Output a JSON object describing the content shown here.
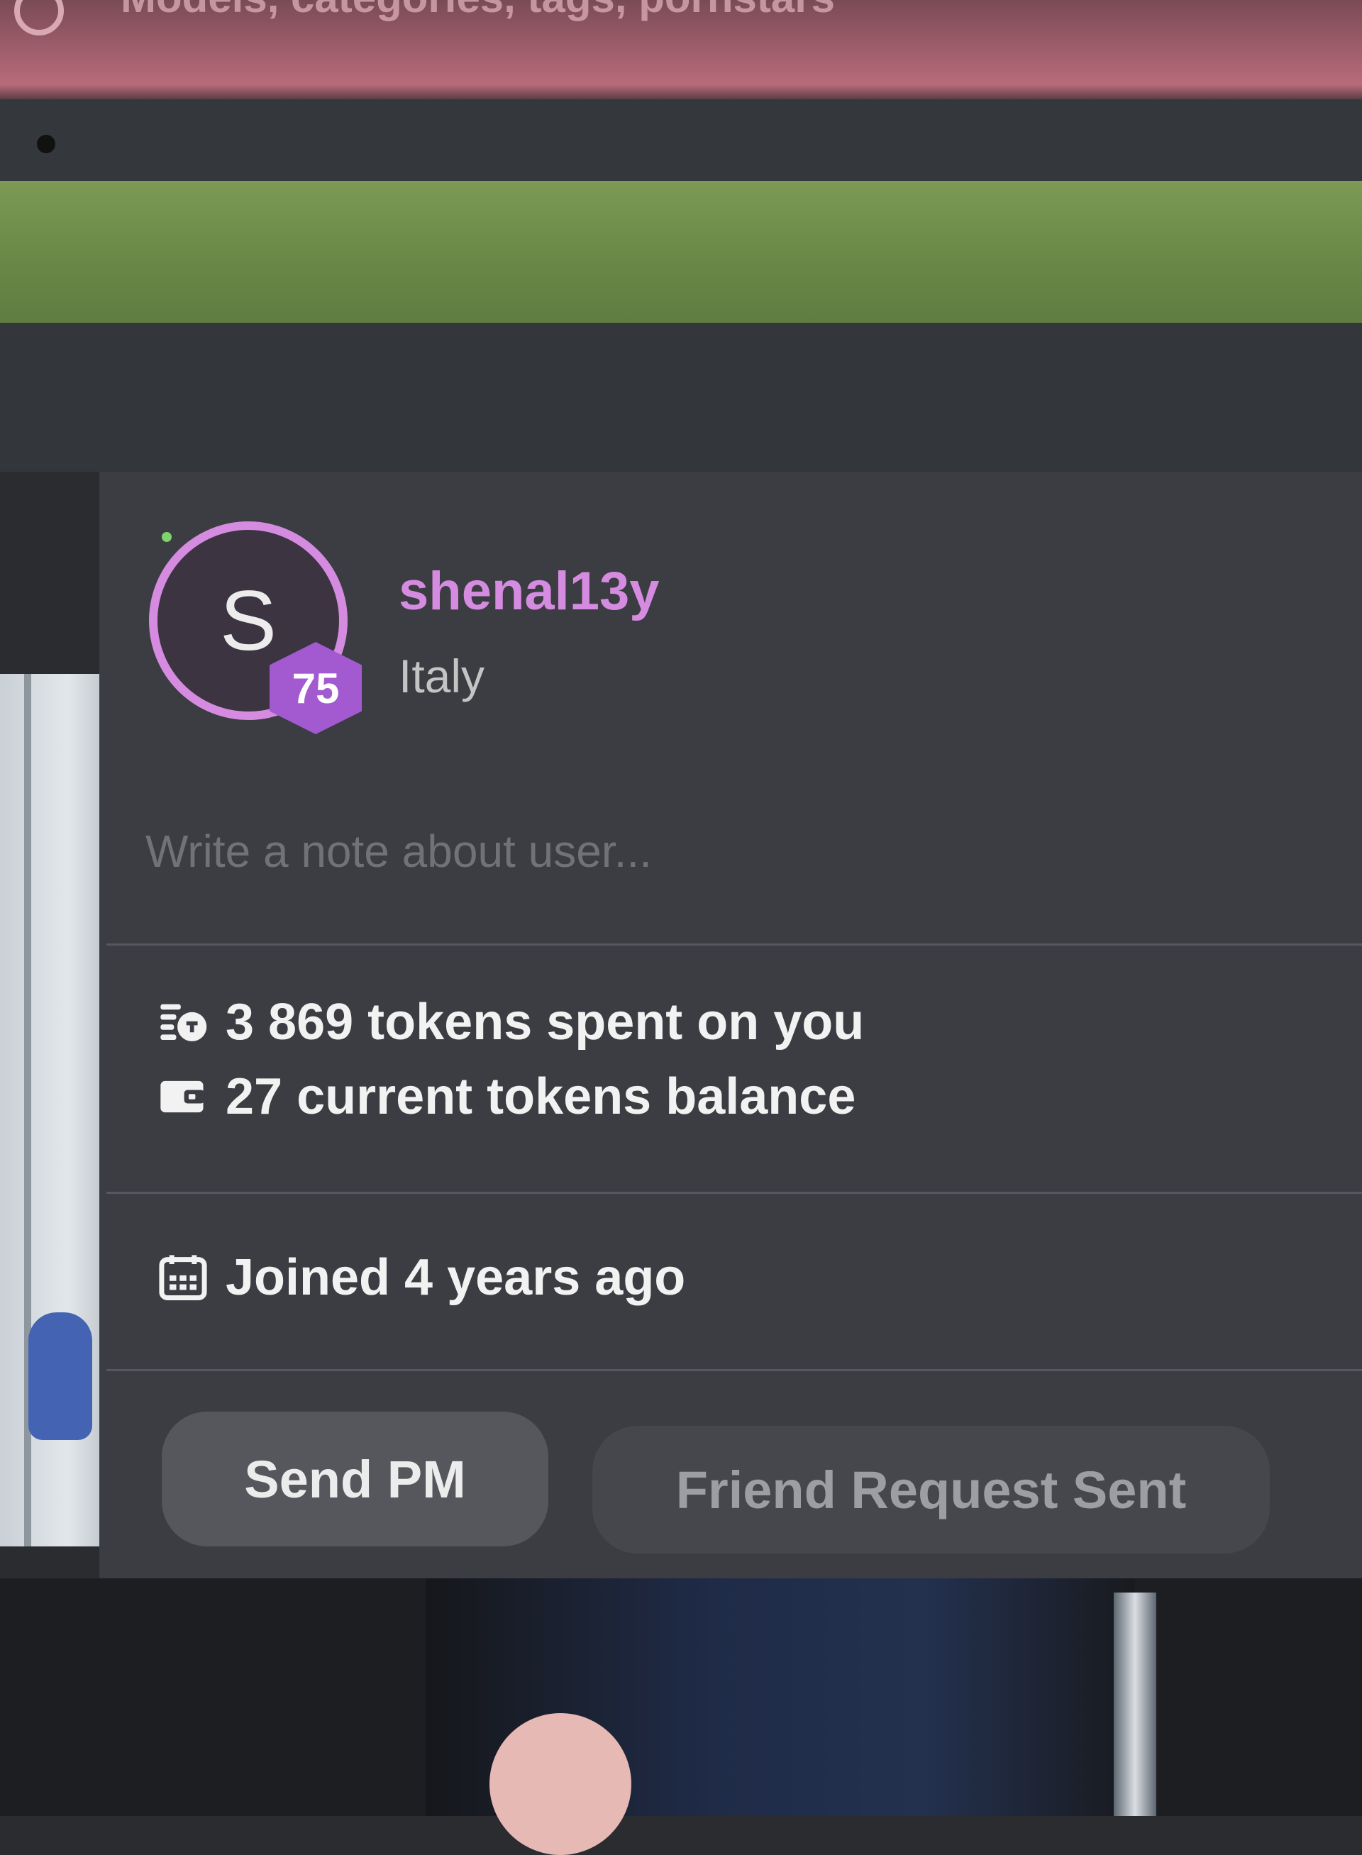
{
  "header": {
    "search_text": "Models, categories, tags, pornstars"
  },
  "profile": {
    "avatar_initial": "S",
    "level": "75",
    "username": "shenal13y",
    "country": "Italy"
  },
  "note": {
    "placeholder": "Write a note about user..."
  },
  "stats": {
    "tokens_spent": "3 869 tokens spent on you",
    "tokens_balance": "27 current tokens balance",
    "joined": "Joined 4 years ago"
  },
  "icons": {
    "tokens_spent": "coins-icon",
    "tokens_balance": "wallet-icon",
    "joined": "calendar-icon"
  },
  "actions": {
    "send_pm": "Send PM",
    "friend_request": "Friend Request Sent"
  },
  "colors": {
    "accent": "#d58be0",
    "badge": "#a35ad0",
    "panel": "#3b3d42",
    "green_band": "#6b8a48",
    "top_bar": "#b86b7a"
  }
}
